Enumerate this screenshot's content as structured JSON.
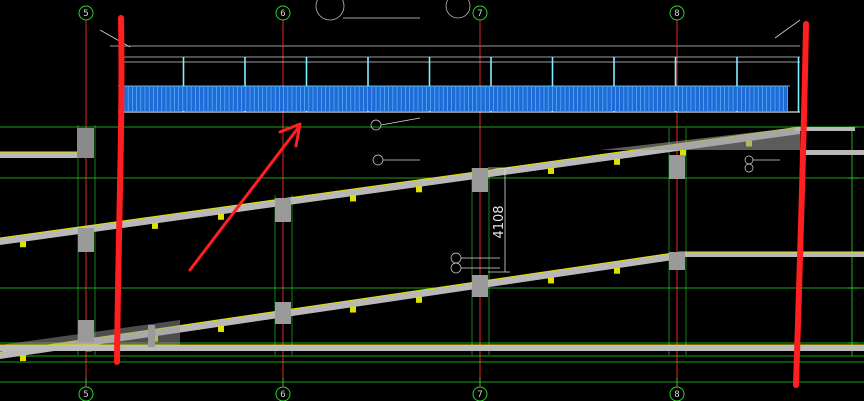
{
  "drawing": {
    "title": "",
    "grid_axes": [
      "5",
      "6",
      "7",
      "8"
    ],
    "dimension_label": "4108",
    "colors": {
      "background": "#000000",
      "grid_line": "#ff2a2a",
      "construction_line": "#26d826",
      "slab": "#b8b8b8",
      "slab_edge": "#e0e000",
      "railing": "#1e6bd6",
      "railing_post": "#7ff0ff",
      "annotation_marker": "#ff1f1f",
      "hatch": "#9a9a9a"
    }
  },
  "ramps": [
    {
      "name": "upper-ramp",
      "x": [
        0,
        800
      ],
      "y_top": [
        238,
        127
      ]
    },
    {
      "name": "lower-ramp",
      "x": [
        0,
        680
      ],
      "y_top": [
        352,
        252
      ]
    }
  ],
  "markup": {
    "highlight_strokes": 2,
    "arrow": "pointing to railing"
  }
}
